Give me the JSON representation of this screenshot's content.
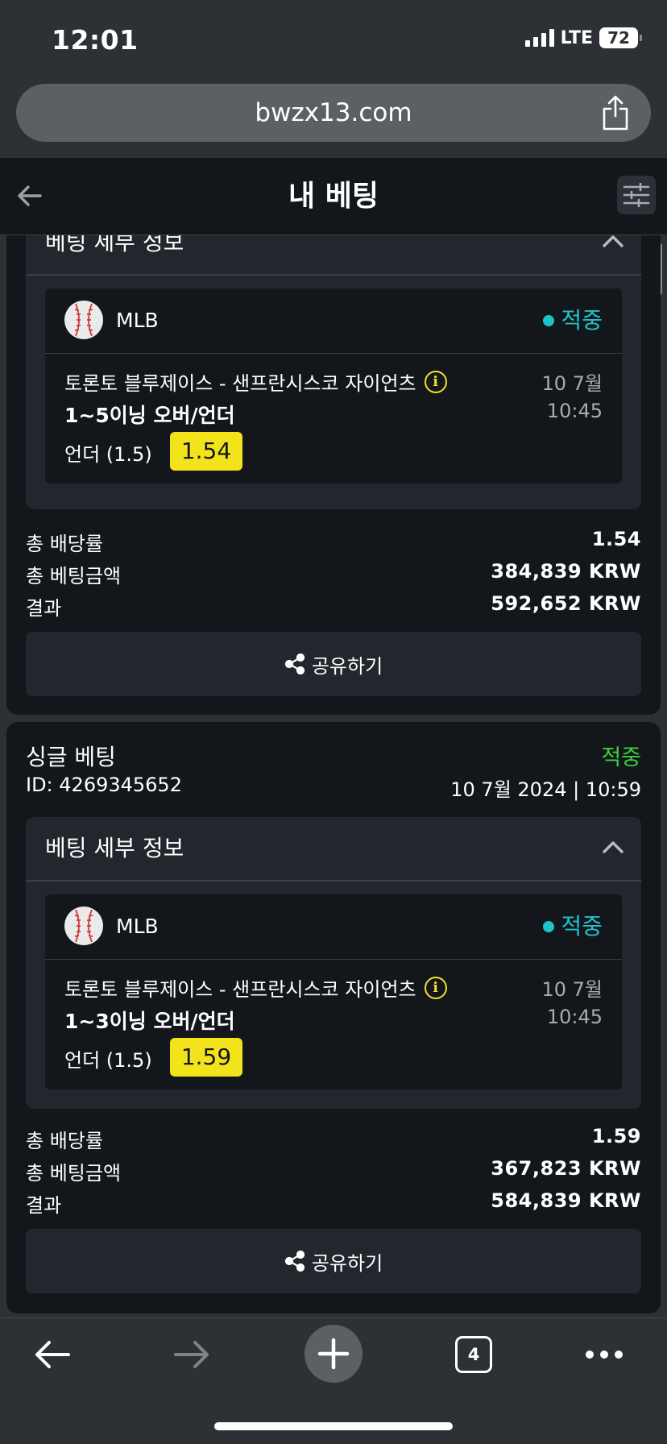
{
  "status_bar": {
    "time": "12:01",
    "network": "LTE",
    "battery": "72"
  },
  "browser": {
    "url": "bwzx13.com",
    "tab_count": "4"
  },
  "header": {
    "title": "내 베팅"
  },
  "cards": [
    {
      "details_title": "베팅 세부 정보",
      "league": "MLB",
      "result": "적중",
      "match": "토론토 블루제이스 - 샌프란시스코 자이언츠",
      "market": "1~5이닝 오버/언더",
      "event_date": "10 7월",
      "event_time": "10:45",
      "pick": "언더 (1.5)",
      "odds": "1.54",
      "total_odds_label": "총 배당률",
      "total_odds": "1.54",
      "stake_label": "총 베팅금액",
      "stake": "384,839 KRW",
      "payout_label": "결과",
      "payout": "592,652 KRW",
      "share_label": "공유하기"
    },
    {
      "title": "싱글 베팅",
      "status": "적중",
      "id": "ID: 4269345652",
      "placed": "10 7월 2024 | 10:59",
      "details_title": "베팅 세부 정보",
      "league": "MLB",
      "result": "적중",
      "match": "토론토 블루제이스 - 샌프란시스코 자이언츠",
      "market": "1~3이닝 오버/언더",
      "event_date": "10 7월",
      "event_time": "10:45",
      "pick": "언더 (1.5)",
      "odds": "1.59",
      "total_odds_label": "총 배당률",
      "total_odds": "1.59",
      "stake_label": "총 베팅금액",
      "stake": "367,823 KRW",
      "payout_label": "결과",
      "payout": "584,839 KRW",
      "share_label": "공유하기"
    }
  ],
  "colors": {
    "win_green": "#3ecf3a",
    "result_teal": "#1ec3c8",
    "odds_yellow": "#f3e31b"
  }
}
